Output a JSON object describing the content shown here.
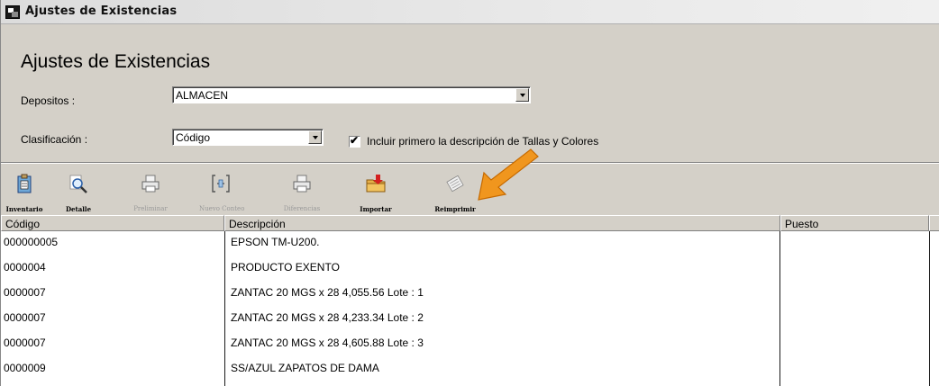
{
  "window": {
    "title": "Ajustes de Existencias",
    "app_icon": "app-window-icon"
  },
  "header": {
    "title": "Ajustes de Existencias",
    "depositos_label": "Depositos :",
    "depositos_value": "ALMACEN",
    "clasificacion_label": "Clasificación :",
    "clasificacion_value": "Código",
    "include_checkbox_label": "Incluir primero la descripción de Tallas y Colores",
    "include_checked": true,
    "include_check_glyph": "✔"
  },
  "toolbar": {
    "items": [
      {
        "label": "Inventario",
        "icon": "clipboard-icon",
        "enabled": true
      },
      {
        "label": "Detalle",
        "icon": "magnifier-icon",
        "enabled": true
      },
      {
        "label": "Preliminar",
        "icon": "printer-preview-icon",
        "enabled": false
      },
      {
        "label": "Nuevo Conteo",
        "icon": "new-count-icon",
        "enabled": false
      },
      {
        "label": "Diferencias",
        "icon": "printer-icon",
        "enabled": false
      },
      {
        "label": "Importar",
        "icon": "import-folder-icon",
        "enabled": true
      },
      {
        "label": "Reimprimir",
        "icon": "reprint-icon",
        "enabled": true
      }
    ]
  },
  "annotation": {
    "arrow_color": "#f0961e",
    "arrow_icon": "orange-pointer-arrow"
  },
  "table": {
    "columns": [
      "Código",
      "Descripción",
      "Puesto",
      ""
    ],
    "rows": [
      [
        "000000005",
        "EPSON TM-U200.",
        "",
        ""
      ],
      [
        "0000004",
        "PRODUCTO EXENTO",
        "",
        ""
      ],
      [
        "0000007",
        "ZANTAC 20 MGS x 28   4,055.56 Lote : 1",
        "",
        ""
      ],
      [
        "0000007",
        "ZANTAC 20 MGS x 28   4,233.34 Lote : 2",
        "",
        ""
      ],
      [
        "0000007",
        "ZANTAC 20 MGS x 28   4,605.88 Lote : 3",
        "",
        ""
      ],
      [
        "0000009",
        "SS/AZUL ZAPATOS DE DAMA",
        "",
        ""
      ]
    ]
  }
}
